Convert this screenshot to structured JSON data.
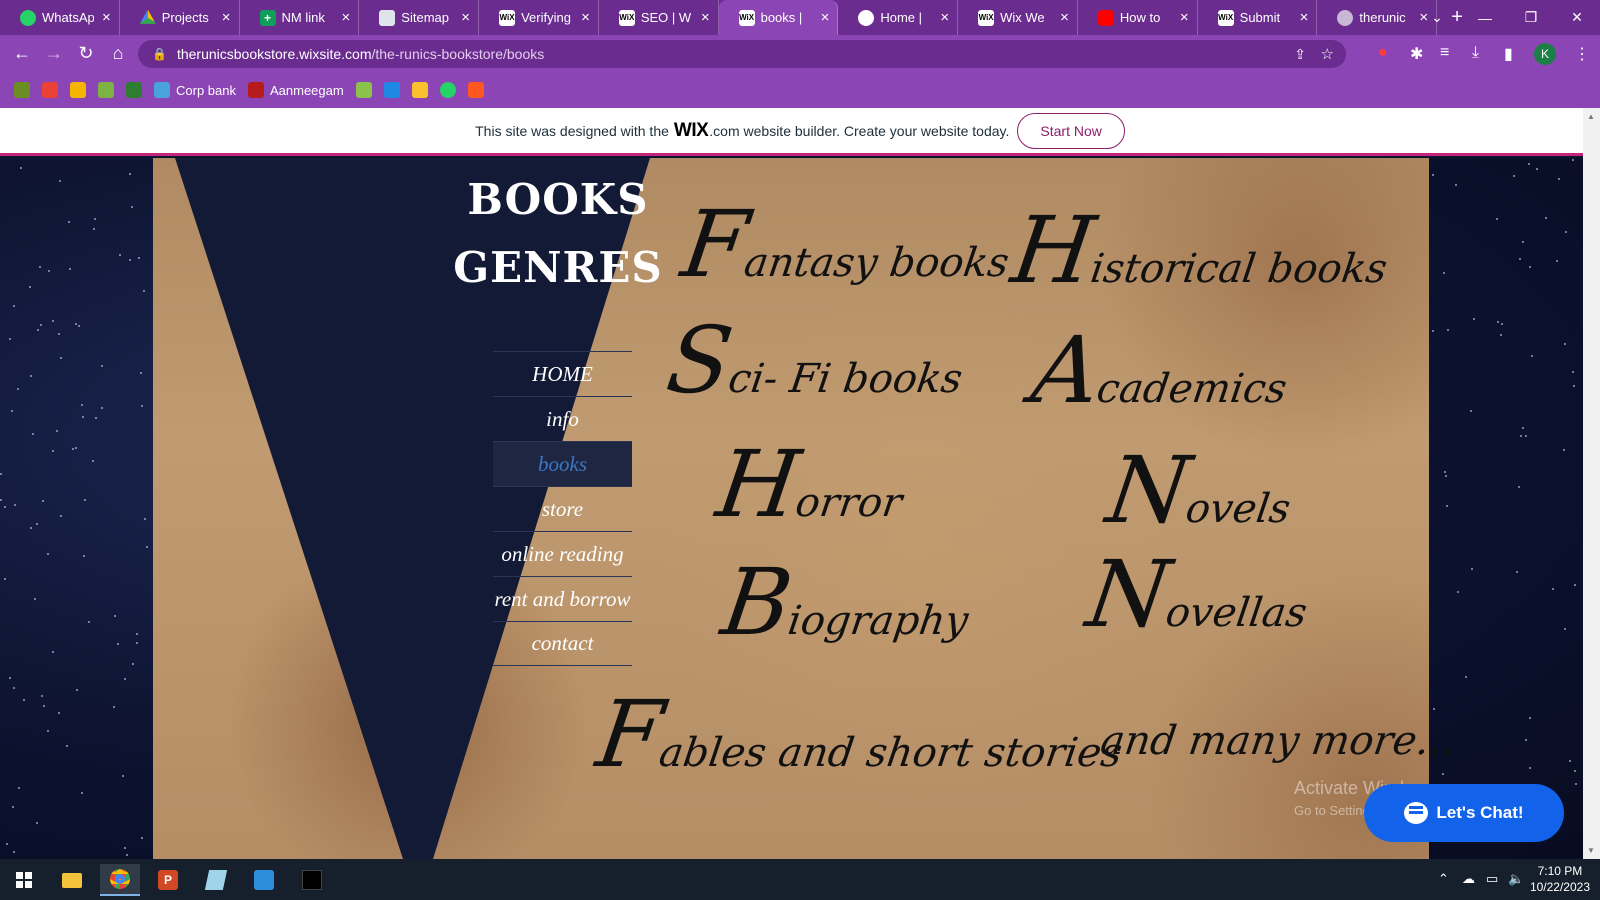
{
  "tabs": [
    {
      "title": "WhatsApp",
      "favicon": "whatsapp-icon"
    },
    {
      "title": "Projects",
      "favicon": "google-drive-icon"
    },
    {
      "title": "NM link",
      "favicon": "google-sheets-icon"
    },
    {
      "title": "Sitemap",
      "favicon": "sitemap-icon"
    },
    {
      "title": "Verifying",
      "favicon": "wix-icon"
    },
    {
      "title": "SEO | W",
      "favicon": "wix-icon"
    },
    {
      "title": "books |",
      "favicon": "wix-icon"
    },
    {
      "title": "Home |",
      "favicon": "home-icon"
    },
    {
      "title": "Wix We",
      "favicon": "wix-icon"
    },
    {
      "title": "How to",
      "favicon": "youtube-icon"
    },
    {
      "title": "Submit",
      "favicon": "wix-icon"
    },
    {
      "title": "therunic",
      "favicon": "globe-icon"
    }
  ],
  "active_tab_index": 6,
  "address_bar": {
    "domain": "therunicsbookstore.wixsite.com",
    "path": "/the-runics-bookstore/books"
  },
  "profile_initial": "K",
  "bookmarks": [
    {
      "label": "",
      "color": "#6b8e23"
    },
    {
      "label": "",
      "color": "#ea4335"
    },
    {
      "label": "",
      "color": "#f4b400"
    },
    {
      "label": "",
      "color": "#7cb342"
    },
    {
      "label": "",
      "color": "#2e7d32"
    },
    {
      "label": "Corp bank",
      "color": "#4aa3df"
    },
    {
      "label": "Aanmeegam",
      "color": "#b71c1c"
    },
    {
      "label": "",
      "color": "#8bc34a"
    },
    {
      "label": "",
      "color": "#1e88e5"
    },
    {
      "label": "",
      "color": "#fbc02d"
    },
    {
      "label": "",
      "color": "#25d366"
    },
    {
      "label": "",
      "color": "#ff5722"
    }
  ],
  "wix_banner": {
    "text_before": "This site was designed with the",
    "logo": "WIX",
    "text_after": ".com website builder. Create your website today.",
    "cta": "Start Now"
  },
  "site": {
    "title_line1": "BOOKS",
    "title_line2": "GENRES",
    "nav": [
      "HOME",
      "info",
      "books",
      "store",
      "online reading",
      "rent and borrow",
      "contact"
    ],
    "active_nav": "books",
    "genres": {
      "fantasy": {
        "initial": "F",
        "rest": "antasy books"
      },
      "historical": {
        "initial": "H",
        "rest": "istorical books"
      },
      "scifi": {
        "initial": "S",
        "rest": "ci- Fi books"
      },
      "academics": {
        "initial": "A",
        "rest": "cademics"
      },
      "horror": {
        "initial": "H",
        "rest": "orror"
      },
      "novels": {
        "initial": "N",
        "rest": "ovels"
      },
      "biography": {
        "initial": "B",
        "rest": "iography"
      },
      "novellas": {
        "initial": "N",
        "rest": "ovellas"
      },
      "fables": {
        "initial": "F",
        "rest": "ables and short stories"
      },
      "more": {
        "initial": "",
        "rest": "and many more..."
      }
    }
  },
  "watermark": {
    "line1": "Activate Windows",
    "line2": "Go to Settings to activate Windows."
  },
  "chat_button": "Let's Chat!",
  "clock": {
    "time": "7:10 PM",
    "date": "10/22/2023"
  }
}
